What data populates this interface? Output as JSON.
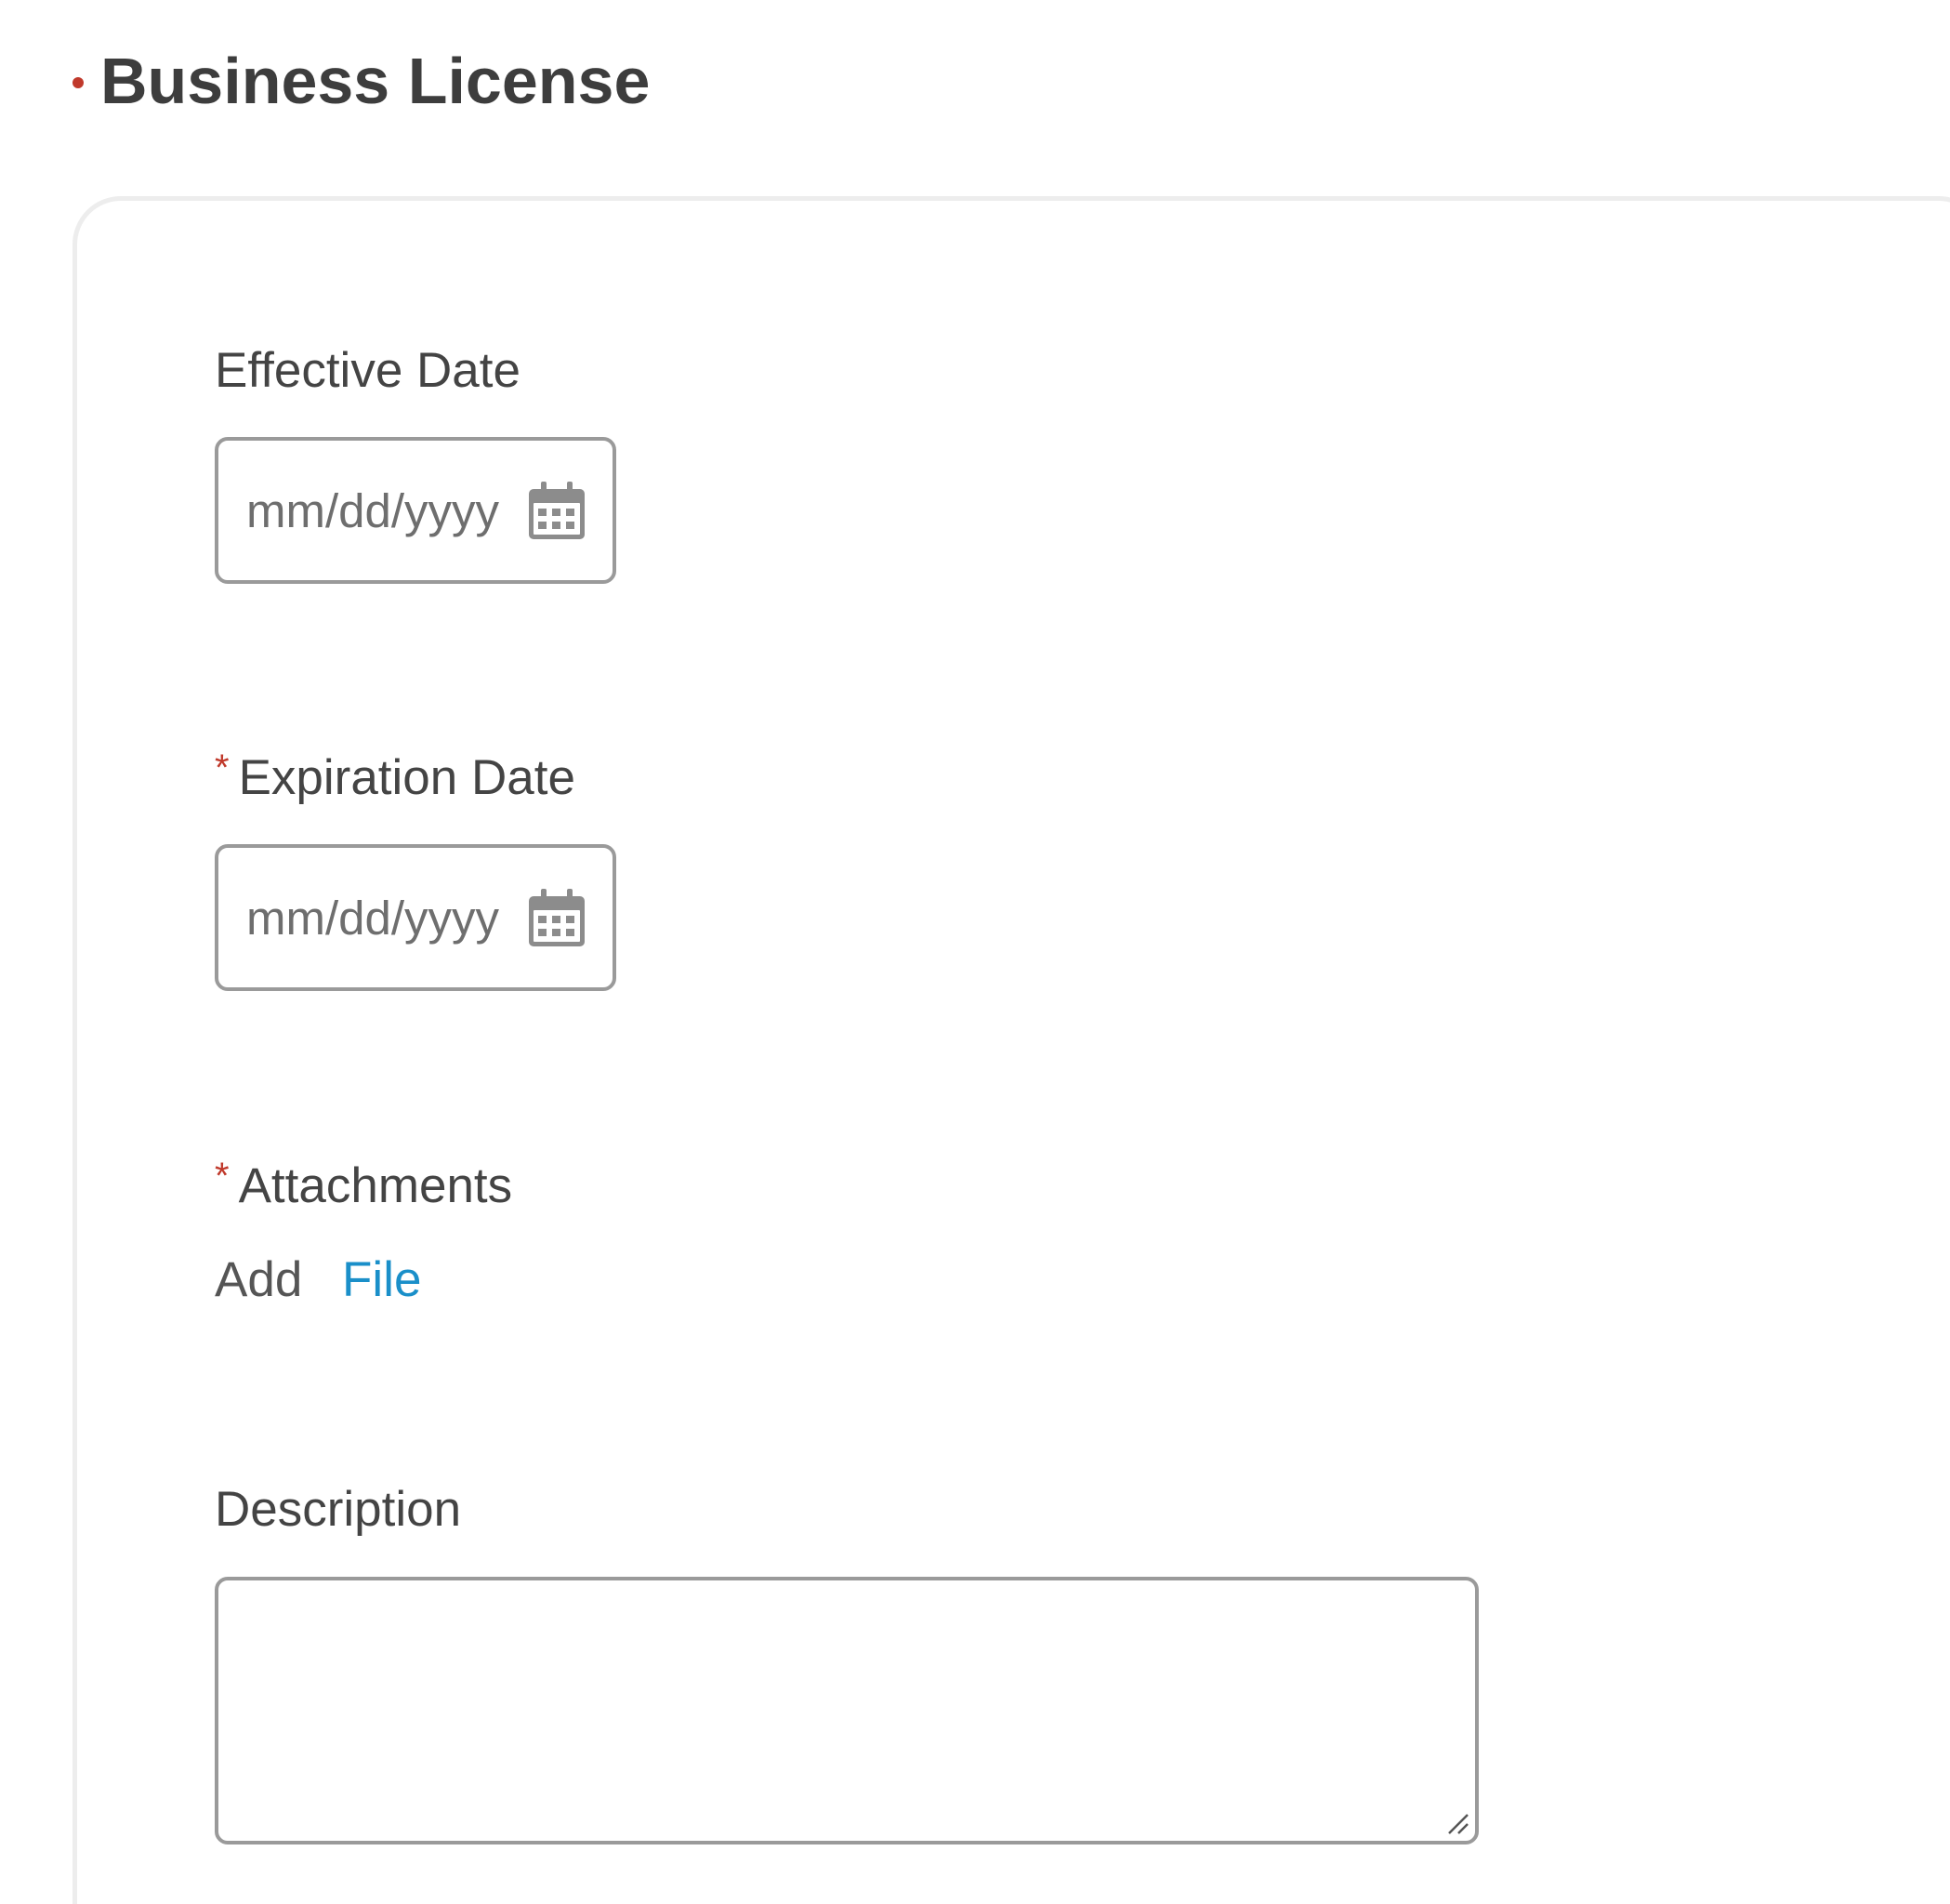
{
  "section": {
    "title": "Business License",
    "bullet_color": "#c0392b"
  },
  "colors": {
    "required": "#c0392b",
    "link": "#1a8fc9",
    "border": "#9a9a9a"
  },
  "fields": {
    "effective_date": {
      "label": "Effective Date",
      "placeholder": "mm/dd/yyyy",
      "required": false,
      "icon": "calendar-icon"
    },
    "expiration_date": {
      "label": "Expiration Date",
      "placeholder": "mm/dd/yyyy",
      "required": true,
      "required_marker": "*",
      "icon": "calendar-icon"
    },
    "attachments": {
      "label": "Attachments",
      "required": true,
      "required_marker": "*",
      "add_text": "Add",
      "file_link": "File"
    },
    "description": {
      "label": "Description",
      "value": "",
      "icon": "resize-handle-icon"
    }
  }
}
